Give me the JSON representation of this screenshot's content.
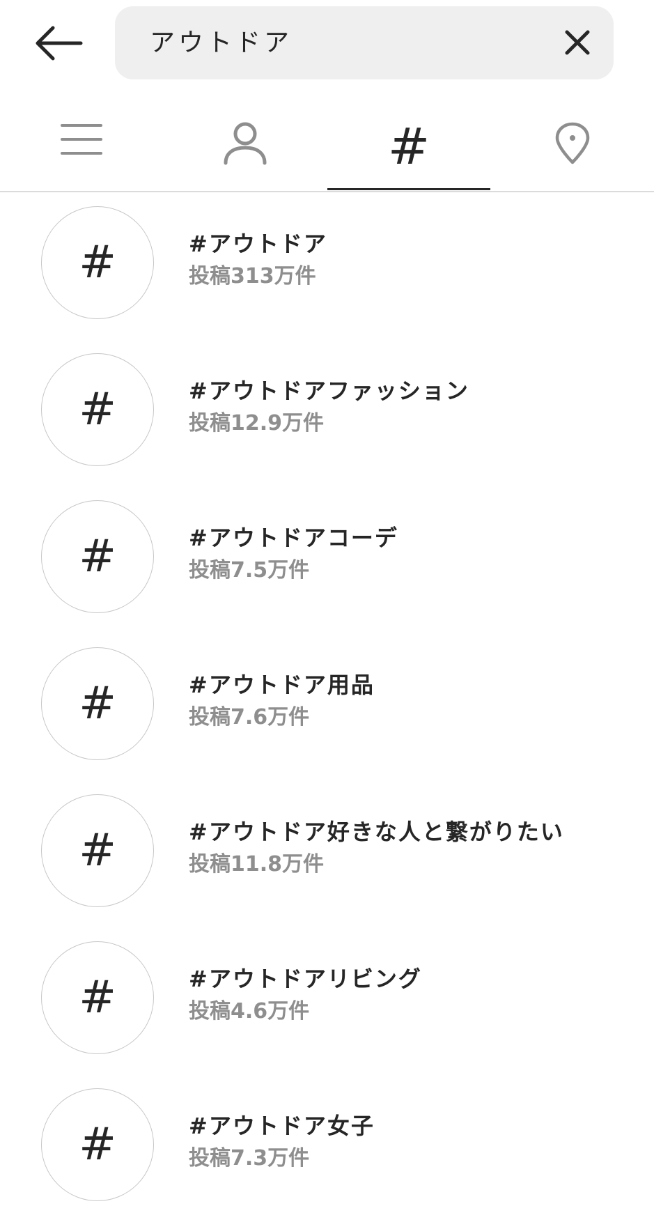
{
  "search": {
    "query": "アウトドア"
  },
  "tabs": [
    {
      "name": "top",
      "icon": "list-icon",
      "active": false
    },
    {
      "name": "accounts",
      "icon": "person-icon",
      "active": false
    },
    {
      "name": "tags",
      "icon": "hashtag-icon",
      "label": "#",
      "active": true
    },
    {
      "name": "places",
      "icon": "location-pin-icon",
      "active": false
    }
  ],
  "results": [
    {
      "icon": "#",
      "name": "#アウトドア",
      "count": "投稿313万件"
    },
    {
      "icon": "#",
      "name": "#アウトドアファッション",
      "count": "投稿12.9万件"
    },
    {
      "icon": "#",
      "name": "#アウトドアコーデ",
      "count": "投稿7.5万件"
    },
    {
      "icon": "#",
      "name": "#アウトドア用品",
      "count": "投稿7.6万件"
    },
    {
      "icon": "#",
      "name": "#アウトドア好きな人と繋がりたい",
      "count": "投稿11.8万件"
    },
    {
      "icon": "#",
      "name": "#アウトドアリビング",
      "count": "投稿4.6万件"
    },
    {
      "icon": "#",
      "name": "#アウトドア女子",
      "count": "投稿7.3万件"
    }
  ],
  "colors": {
    "text": "#262626",
    "secondary_text": "#8e8e8e",
    "icon_gray": "#8e8e8e",
    "search_bg": "#efefef",
    "divider": "#dbdbdb"
  }
}
